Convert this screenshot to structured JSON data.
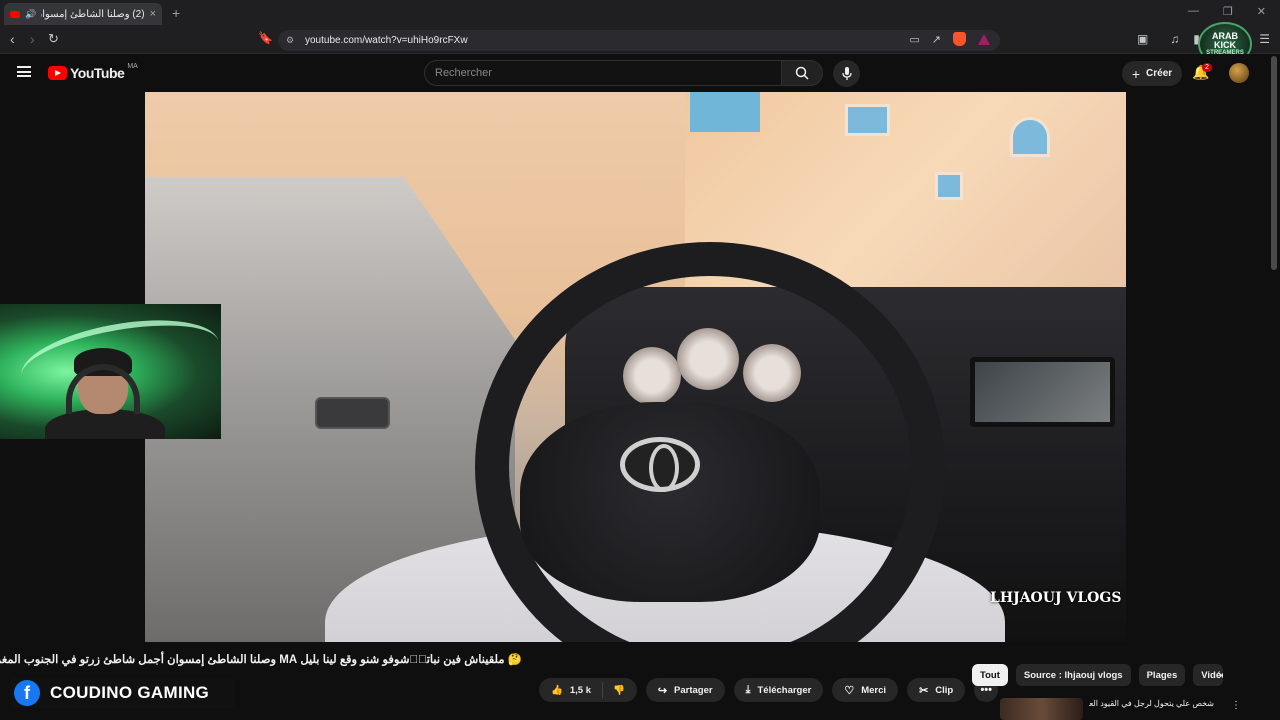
{
  "browser": {
    "tab_title": "(2) وصلنا الشاطئ إمسوان أجم...",
    "tab_close": "×",
    "new_tab": "+",
    "url": "youtube.com/watch?v=uhiHo9rcFXw",
    "window_controls": [
      "—",
      "❐",
      "✕"
    ],
    "streamer_logo": {
      "line1": "ARAB KICK",
      "line2": "STREAMERS"
    }
  },
  "youtube": {
    "brand": "YouTube",
    "country_code": "MA",
    "search_placeholder": "Rechercher",
    "create_label": "Créer",
    "notification_count": "2"
  },
  "video": {
    "watermark": "LHJAOUJ VLOGS",
    "title": "🤔 ملقيناش فين نباتو🏻شوفو شنو وقع لينا بليل MA وصلنا الشاطئ إمسوان أجمل شاطئ زرتو في الجنوب المغرب"
  },
  "overlay": {
    "channel_name": "COUDINO GAMING",
    "fb_letter": "f"
  },
  "actions": {
    "like_count": "1,5 k",
    "share": "Partager",
    "download": "Télécharger",
    "thanks": "Merci",
    "clip": "Clip",
    "more": "•••"
  },
  "chips": {
    "all": "Tout",
    "source": "Source : lhjaouj vlogs",
    "beaches": "Plages",
    "videos": "Vidéo"
  },
  "sidebar": {
    "first_title": "شخص علي يتحول لرجل في القيود العالية..."
  },
  "colors": {
    "accent_red": "#ff0000",
    "facebook_blue": "#1877f2",
    "background": "#0f0f0f"
  }
}
